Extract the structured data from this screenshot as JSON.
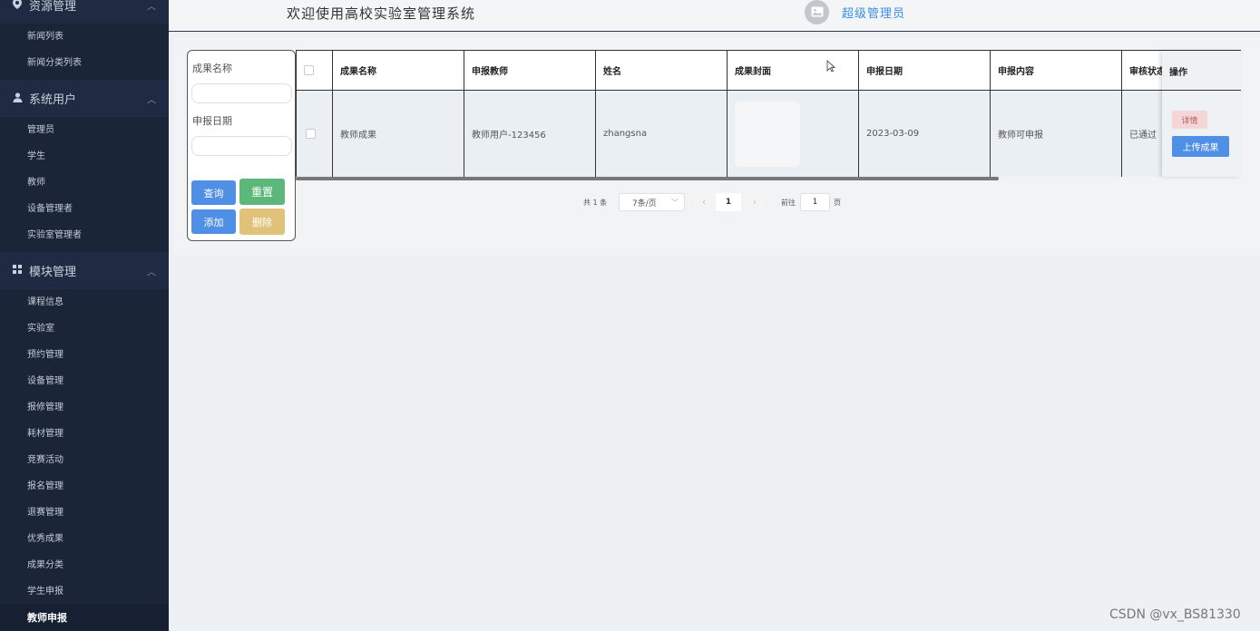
{
  "sidebar": {
    "groups": [
      {
        "title": "资源管理",
        "icon": "location-pin-icon",
        "items": [
          "新闻列表",
          "新闻分类列表"
        ]
      },
      {
        "title": "系统用户",
        "icon": "user-icon",
        "items": [
          "管理员",
          "学生",
          "教师",
          "设备管理者",
          "实验室管理者"
        ]
      },
      {
        "title": "模块管理",
        "icon": "grid-icon",
        "items": [
          "课程信息",
          "实验室",
          "预约管理",
          "设备管理",
          "报修管理",
          "耗材管理",
          "竞赛活动",
          "报名管理",
          "退赛管理",
          "优秀成果",
          "成果分类",
          "学生申报",
          "教师申报"
        ]
      }
    ],
    "active_item": "教师申报"
  },
  "header": {
    "welcome": "欢迎使用高校实验室管理系统",
    "role": "超级管理员"
  },
  "search": {
    "name_label": "成果名称",
    "date_label": "申报日期",
    "query_btn": "查询",
    "reset_btn": "重置",
    "add_btn": "添加",
    "delete_btn": "删除"
  },
  "table": {
    "columns": [
      "成果名称",
      "申报教师",
      "姓名",
      "成果封面",
      "申报日期",
      "申报内容",
      "审核状态",
      "操作"
    ],
    "rows": [
      {
        "name": "教师成果",
        "teacher": "教师用户-123456",
        "real_name": "zhangsna",
        "date": "2023-03-09",
        "content": "教师可申报",
        "status": "已通过"
      }
    ],
    "detail_btn": "详情",
    "upload_btn": "上传成果"
  },
  "pagination": {
    "total": "共 1 条",
    "page_size": "7条/页",
    "current_page": "1",
    "goto_label": "前往",
    "goto_value": "1",
    "page_unit": "页"
  },
  "watermark": "CSDN @vx_BS81330",
  "colors": {
    "sidebar_bg": "#1b2538",
    "primary": "#4f8fe6",
    "success": "#5cb87a",
    "warning": "#e0c27a",
    "danger_light": "#f5d6d6"
  }
}
